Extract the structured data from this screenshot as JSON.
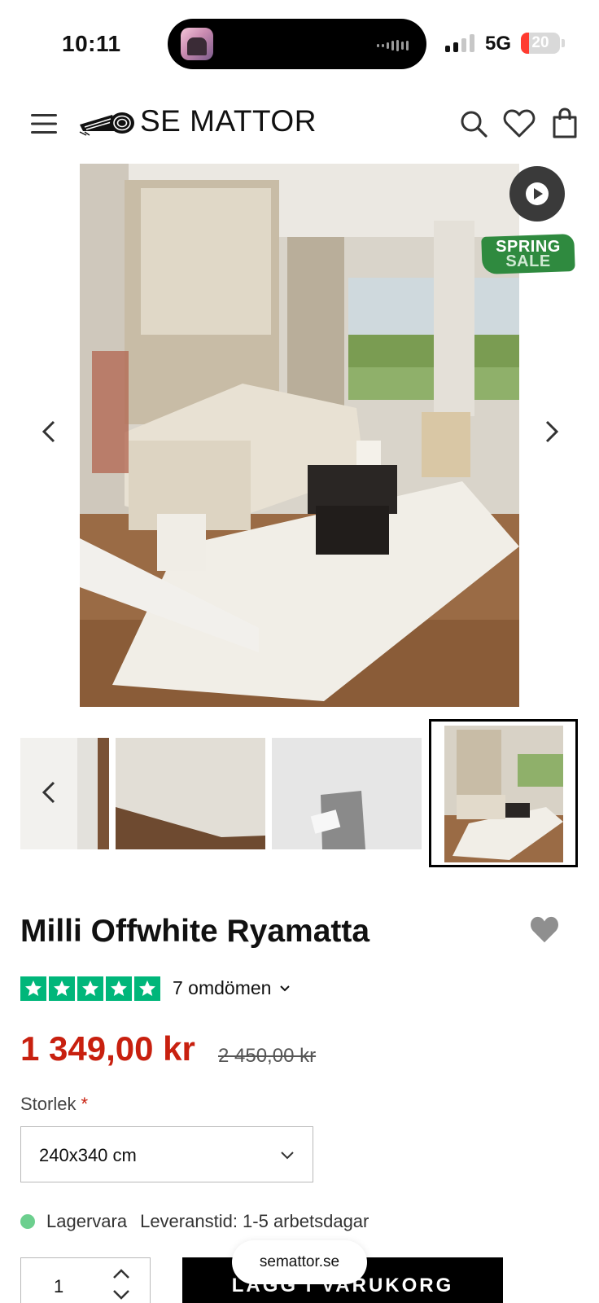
{
  "status_bar": {
    "time": "10:11",
    "network": "5G",
    "battery": "20",
    "battery_level": 0.2
  },
  "header": {
    "logo_text": "SE MATTOR",
    "icons": [
      "menu-icon",
      "search-icon",
      "heart-icon",
      "bag-icon"
    ]
  },
  "hero": {
    "sale_line1": "SPRING",
    "sale_line2": "SALE",
    "colors": {
      "sale_badge": "#2f8a3f",
      "play_button": "#3a3a3a"
    }
  },
  "product": {
    "title": "Milli Offwhite Ryamatta",
    "rating_stars": 5,
    "reviews": "7 omdömen",
    "price_now": "1 349,00 kr",
    "price_old": "2 450,00 kr",
    "size_label": "Storlek",
    "size_required": "*",
    "size_value": "240x340 cm",
    "stock_status": "Lagervara",
    "delivery": "Leveranstid: 1-5 arbetsdagar",
    "quantity": "1",
    "add_to_cart": "LÄGG I VARUKORG",
    "colors": {
      "price": "#c8200f",
      "stars": "#00b67a",
      "stock_dot": "#6ccf8e"
    }
  },
  "browser": {
    "url": "semattor.se"
  }
}
